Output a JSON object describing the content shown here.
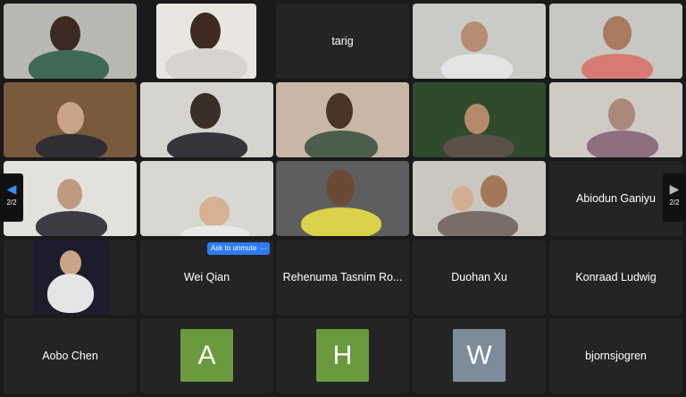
{
  "participants": {
    "tarig": "tarig",
    "abiodun": "Abiodun Ganiyu",
    "wei": "Wei Qian",
    "rehenuma": "Rehenuma Tasnim Ro...",
    "duohan": "Duohan Xu",
    "konraad": "Konraad Ludwig",
    "aobo": "Aobo Chen",
    "bjorn": "bjornsjogren"
  },
  "avatars": {
    "a": {
      "letter": "A",
      "color": "#6a9a3d"
    },
    "h": {
      "letter": "H",
      "color": "#6a9a3d"
    },
    "w": {
      "letter": "W",
      "color": "#7c8c98"
    }
  },
  "controls": {
    "ask_to_unmute": "Ask to unmute",
    "more": "…",
    "page_left": "2/2",
    "page_right": "2/2"
  }
}
